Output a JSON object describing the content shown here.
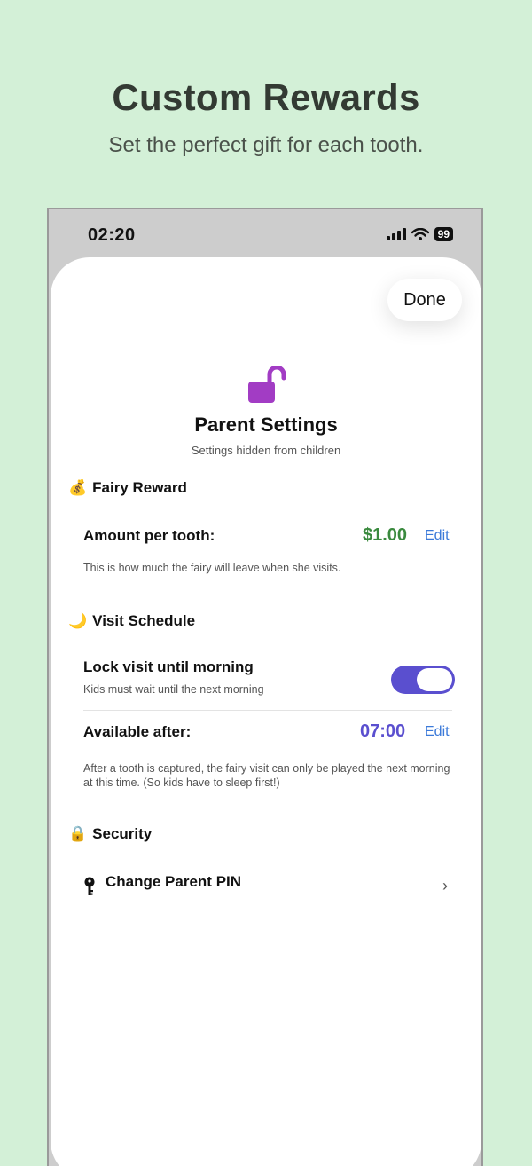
{
  "promo": {
    "headline": "Custom Rewards",
    "subline": "Set the perfect gift for each tooth."
  },
  "status_bar": {
    "time": "02:20",
    "battery": "99"
  },
  "sheet": {
    "done_label": "Done",
    "title": "Parent Settings",
    "subtitle": "Settings hidden from children"
  },
  "fairy_reward": {
    "emoji": "💰",
    "header": "Fairy Reward",
    "amount_label": "Amount per tooth:",
    "amount_value": "$1.00",
    "edit_label": "Edit",
    "note": "This is how much the fairy will leave when she visits."
  },
  "visit_schedule": {
    "emoji": "🌙",
    "header": "Visit Schedule",
    "lock_label": "Lock visit until morning",
    "lock_note": "Kids must wait until the next morning",
    "lock_enabled": true,
    "available_label": "Available after:",
    "available_value": "07:00",
    "edit_label": "Edit",
    "note": "After a tooth is captured, the fairy visit can only be played the next morning at this time. (So kids have to sleep first!)"
  },
  "security": {
    "emoji": "🔒",
    "header": "Security",
    "change_pin_label": "Change Parent PIN"
  },
  "colors": {
    "background": "#d3f0d7",
    "accent_purple": "#5a4fcf",
    "amount_green": "#3a8a3e",
    "link_blue": "#3c7ad9",
    "lock_magenta": "#a23cc4"
  }
}
